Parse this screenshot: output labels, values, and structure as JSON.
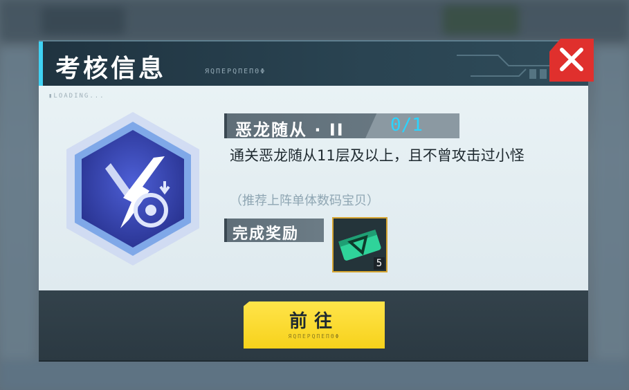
{
  "dialog": {
    "title": "考核信息",
    "subtitle_glyphs": "ЯQΠЕΡQΠЕΠΘΦ",
    "loading_text": "▮LOADING...",
    "close_icon": "close-icon"
  },
  "task": {
    "name": "恶龙随从 · II",
    "progress": "0/1",
    "description": "通关恶龙随从11层及以上，且不曾攻击过小怪",
    "hint": "（推荐上阵单体数码宝贝）"
  },
  "reward": {
    "label": "完成奖励",
    "item_icon": "green-ticket-icon",
    "count": "5"
  },
  "action": {
    "go_label": "前往",
    "go_sub": "ЯQΠЕΡQΠЕΠΘΦ"
  },
  "colors": {
    "accent_cyan": "#3fd2f4",
    "progress_cyan": "#2ad4ff",
    "close_red": "#e0302d",
    "button_yellow": "#f7d21b",
    "reward_border_gold": "#d6a531"
  }
}
